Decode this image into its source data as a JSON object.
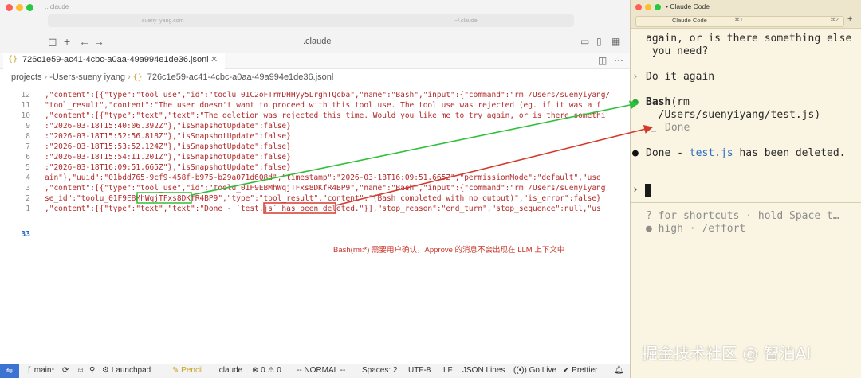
{
  "editor": {
    "tab_strip_text": "...claude",
    "url_left": "sueny iyang.com",
    "url_right": "~/.claude",
    "window_title": ".claude",
    "active_tab": "726c1e59-ac41-4cbc-a0aa-49a994e1de36.jsonl",
    "breadcrumb": [
      "projects",
      "-Users-sueny iyang",
      "726c1e59-ac41-4cbc-a0aa-49a994e1de36.jsonl"
    ],
    "lines": [
      {
        "n": "12",
        "text": ",\"content\":[{\"type\":\"tool_use\",\"id\":\"toolu_01C2oFTrmDHHyy5LrghTQcba\",\"name\":\"Bash\",\"input\":{\"command\":\"rm /Users/suenyiyang/"
      },
      {
        "n": "11",
        "text": "\"tool_result\",\"content\":\"The user doesn't want to proceed with this tool use. The tool use was rejected (eg. if it was a f"
      },
      {
        "n": "10",
        "text": ",\"content\":[{\"type\":\"text\",\"text\":\"The deletion was rejected this time. Would you like me to try again, or is there somethi"
      },
      {
        "n": "9",
        "text": ":\"2026-03-18T15:40:06.392Z\"},\"isSnapshotUpdate\":false}"
      },
      {
        "n": "8",
        "text": ":\"2026-03-18T15:52:56.818Z\"},\"isSnapshotUpdate\":false}"
      },
      {
        "n": "7",
        "text": ":\"2026-03-18T15:53:52.124Z\"},\"isSnapshotUpdate\":false}"
      },
      {
        "n": "6",
        "text": ":\"2026-03-18T15:54:11.201Z\"},\"isSnapshotUpdate\":false}"
      },
      {
        "n": "5",
        "text": ":\"2026-03-18T16:09:51.665Z\"},\"isSnapshotUpdate\":false}"
      },
      {
        "n": "4",
        "text": "ain\"},\"uuid\":\"01bdd765-9cf9-458f-b975-b29a071d608d\",\"timestamp\":\"2026-03-18T16:09:51.665Z\",\"permissionMode\":\"default\",\"use"
      },
      {
        "n": "3",
        "text": ",\"content\":[{\"type\":\"tool_use\",\"id\":\"toolu_01F9EBMhWqjTFxs8DKfR4BP9\",\"name\":\"Bash\",\"input\":{\"command\":\"rm /Users/suenyiyang"
      },
      {
        "n": "2",
        "text": "se_id\":\"toolu_01F9EBMhWqjTFxs8DKfR4BP9\",\"type\":\"tool_result\",\"content\":\"(Bash completed with no output)\",\"is_error\":false}"
      },
      {
        "n": "1",
        "text": ",\"content\":[{\"type\":\"text\",\"text\":\"Done - `test.js` has been deleted.\"}],\"stop_reason\":\"end_turn\",\"stop_sequence\":null,\"us"
      },
      {
        "n": "33",
        "text": ""
      }
    ],
    "annotation": "Bash(rm:*) 需要用户确认，Approve 的消息不会出现在 LLM 上下文中",
    "status": {
      "branch": "main*",
      "launchpad": "Launchpad",
      "pencil": "Pencil",
      "folder": ".claude",
      "problems": "0 ⚠ 0",
      "mode": "-- NORMAL --",
      "spaces": "Spaces: 2",
      "encoding": "UTF-8",
      "eol": "LF",
      "language": "JSON Lines",
      "golive": "Go Live",
      "prettier": "Prettier"
    }
  },
  "terminal": {
    "title": "• Claude Code",
    "tab_label": "Claude Code",
    "tab_key1": "⌘1",
    "tab_key2": "⌘2",
    "msg1_line1": "again, or is there something else",
    "msg1_line2": " you need?",
    "user_prompt": "Do it again",
    "bash_head": "Bash",
    "bash_arg1": "(rm",
    "bash_arg2": "  /Users/suenyiyang/test.js)",
    "bash_result": "Done",
    "done_prefix": "Done - ",
    "done_file": "test.js",
    "done_suffix": " has been deleted.",
    "hint1": "? for shortcuts · hold Space t…",
    "hint2": "● high · /effort"
  },
  "watermark": "掘金技术社区 @ 智泊AI",
  "colors": {
    "green_arrow": "#2fbf3a",
    "red_arrow": "#d23a2b",
    "terminal_bg": "#faf5e2",
    "accent_blue": "#3a73d1"
  }
}
